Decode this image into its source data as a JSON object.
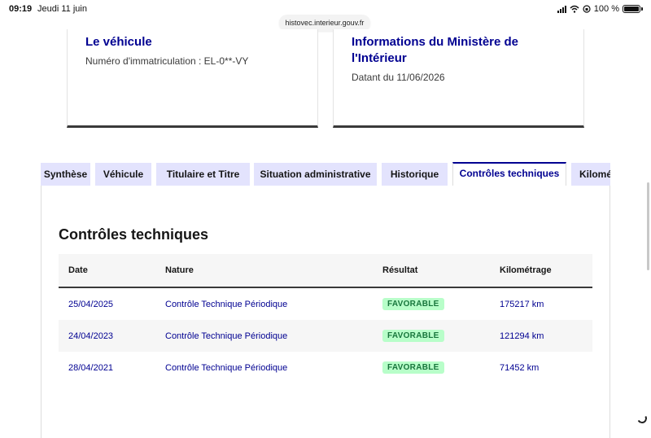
{
  "status_bar": {
    "time": "09:19",
    "date": "Jeudi 11 juin",
    "battery": "100 %"
  },
  "browser": {
    "url": "histovec.interieur.gouv.fr"
  },
  "vehicle_card": {
    "title": "Le véhicule",
    "plate": "Numéro d'immatriculation : EL-0**-VY"
  },
  "ministry_card": {
    "title": "Informations du Ministère de l'Intérieur",
    "date": "Datant du 11/06/2026"
  },
  "tabs": [
    {
      "label": "Synthèse",
      "active": false
    },
    {
      "label": "Véhicule",
      "active": false
    },
    {
      "label": "Titulaire et Titre",
      "active": false
    },
    {
      "label": "Situation administrative",
      "active": false
    },
    {
      "label": "Historique",
      "active": false
    },
    {
      "label": "Contrôles techniques",
      "active": true
    },
    {
      "label": "Kilométrage",
      "active": false
    }
  ],
  "ct_section": {
    "title": "Contrôles techniques",
    "columns": [
      "Date",
      "Nature",
      "Résultat",
      "Kilométrage"
    ],
    "rows": [
      {
        "date": "25/04/2025",
        "nature": "Contrôle Technique Périodique",
        "result": "FAVORABLE",
        "km": "175217 km"
      },
      {
        "date": "24/04/2023",
        "nature": "Contrôle Technique Périodique",
        "result": "FAVORABLE",
        "km": "121294 km"
      },
      {
        "date": "28/04/2021",
        "nature": "Contrôle Technique Périodique",
        "result": "FAVORABLE",
        "km": "71452 km"
      }
    ]
  },
  "colors": {
    "accent": "#000091",
    "tab_bg": "#e3e3fd",
    "badge_bg": "#b8fec9",
    "badge_text": "#18753c"
  }
}
